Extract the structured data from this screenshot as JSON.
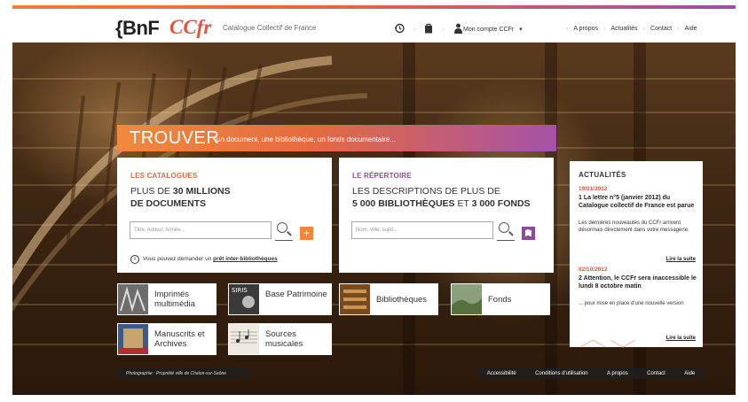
{
  "header": {
    "logo_bnf": "{BnF",
    "logo_ccfr": "CCfr",
    "tagline": "Catalogue Collectif de France",
    "account_label": "Mon compte CCFr",
    "account_arrow": "▾",
    "nav": [
      "A propos",
      "Actualités",
      "Contact",
      "Aide"
    ],
    "icons": [
      "history-icon",
      "basket-icon",
      "user-icon"
    ]
  },
  "trouver": {
    "title": "TROUVER",
    "subtitle": "un document, une bibliothèque, un fonds documentaire..."
  },
  "catalogues": {
    "heading": "LES CATALOGUES",
    "line1_prefix": "PLUS DE ",
    "line1_bold": "30 MILLIONS",
    "line2_bold": "DE DOCUMENTS",
    "search_placeholder": "Titre, Auteur, Année...",
    "plus_button": "+",
    "pret_prefix": "Vous pouvez demander un ",
    "pret_link": "prêt inter-bibliothèques",
    "accent": "#e8673d"
  },
  "repertoire": {
    "heading": "LE RÉPERTOIRE",
    "line1": "LES DESCRIPTIONS DE PLUS DE",
    "line2_bold1": "5 000 BIBLIOTHÈQUES",
    "line2_mid": " ET ",
    "line2_bold2": "3 000 FONDS",
    "search_placeholder": "Nom, ville, sujet...",
    "accent": "#8e4a9c"
  },
  "tiles": [
    {
      "label": "Imprimés multimédia"
    },
    {
      "label": "Base Patrimoine"
    },
    {
      "label": "Bibliothèques"
    },
    {
      "label": "Fonds"
    },
    {
      "label": "Manuscrits et Archives"
    },
    {
      "label": "Sources musicales"
    }
  ],
  "news": {
    "title": "ACTUALITÉS",
    "items": [
      {
        "date": "19/01/2012",
        "headline": "1 La lettre n°5 (janvier 2012) du Catalogue collectif de France est parue",
        "body": "Les dernières nouveautés du CCFr arrivent désormais directement dans votre messagerie.",
        "more": "Lire la suite"
      },
      {
        "date": "02/10/2012",
        "headline": "2 Attention, le CCFr sera inaccessible le lundi 8 octobre matin",
        "body": "... pour mise en place d'une nouvelle version",
        "more": "Lire la suite"
      }
    ]
  },
  "credit": "Photographie : Propriété ville de Chalon-sur-Saône",
  "footer": [
    "Accessibilité",
    "Conditions d'utilisation",
    "A propos",
    "Contact",
    "Aide"
  ]
}
